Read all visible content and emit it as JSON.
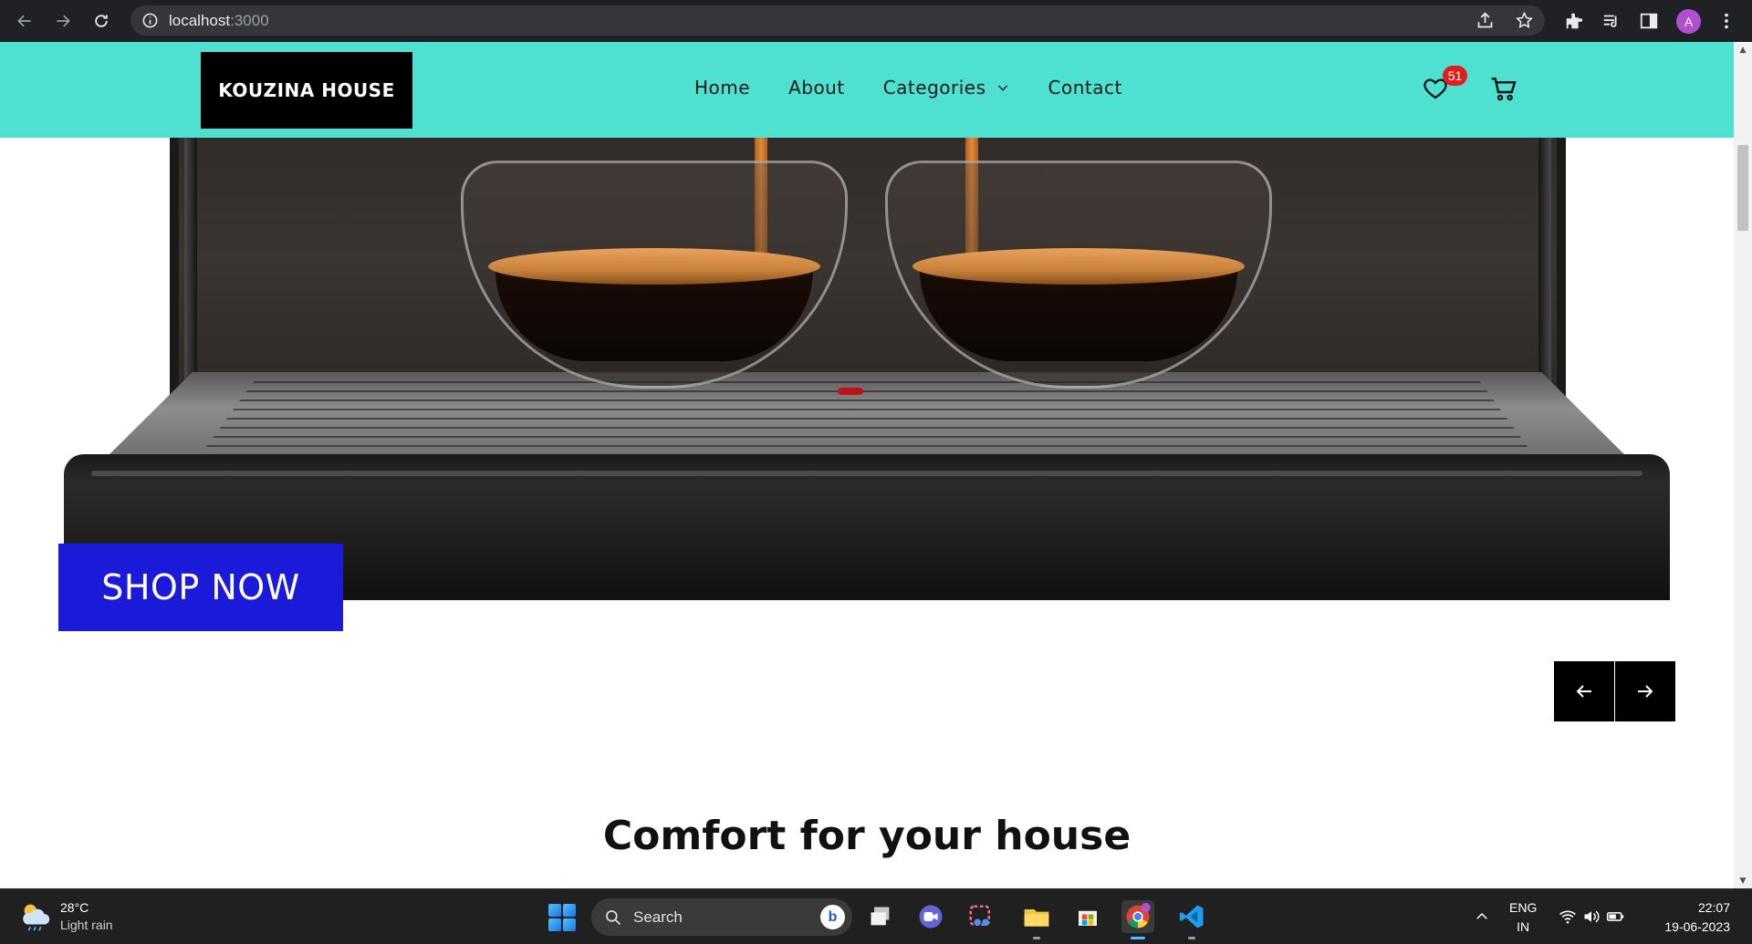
{
  "browser": {
    "url_host": "localhost",
    "url_port": ":3000",
    "profile_initial": "A"
  },
  "site": {
    "logo": "KOUZINA HOUSE",
    "nav": [
      {
        "label": "Home"
      },
      {
        "label": "About"
      },
      {
        "label": "Categories",
        "has_dropdown": true
      },
      {
        "label": "Contact"
      }
    ],
    "wishlist_count": "51",
    "hero": {
      "cta_label": "SHOP NOW"
    },
    "section_title": "Comfort for your house",
    "colors": {
      "navbar": "#4ee0d0",
      "cta": "#1a1ad8",
      "badge": "#e11d1d"
    }
  },
  "taskbar": {
    "weather_temp": "28°C",
    "weather_desc": "Light rain",
    "search_label": "Search",
    "lang_top": "ENG",
    "lang_bottom": "IN",
    "time": "22:07",
    "date": "19-06-2023"
  }
}
